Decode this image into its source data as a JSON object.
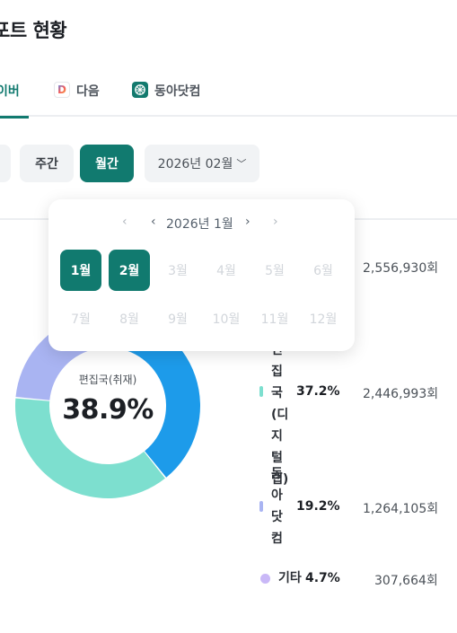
{
  "page": {
    "title": "포트 현황"
  },
  "tabs": [
    {
      "label": "이버",
      "icon": "naver-icon",
      "active": true
    },
    {
      "label": "다음",
      "icon": "daum-icon",
      "active": false
    },
    {
      "label": "동아닷컴",
      "icon": "donga-icon",
      "active": false
    }
  ],
  "filters": {
    "week_label": "주간",
    "month_label": "월간",
    "date_value": "2026년 02월",
    "date_chevron": "﹀"
  },
  "colors": {
    "accent": "#117a6f",
    "cyan": "#1d9bea",
    "mint": "#7ddfcf",
    "periwinkle": "#a9b4f2",
    "lavender": "#c9b8f7"
  },
  "donut": {
    "center_label": "편집국(취재)",
    "center_value": "38.9%"
  },
  "chart_data": {
    "type": "pie",
    "series": [
      {
        "name": "",
        "value": 38.9,
        "color": "#1d9bea"
      },
      {
        "name": "편집국 (디지털랩)",
        "value": 37.2,
        "color": "#7ddfcf"
      },
      {
        "name": "동아닷컴",
        "value": 19.2,
        "color": "#a9b4f2"
      },
      {
        "name": "기타",
        "value": 4.7,
        "color": "#c9b8f7"
      }
    ]
  },
  "legend": [
    {
      "name_lines": [
        "",
        ""
      ],
      "pct": "",
      "count": "2,556,930회"
    },
    {
      "name_lines": [
        "편집",
        "국",
        "(디",
        "지털",
        "랩)"
      ],
      "pct": "37.2%",
      "count": "2,446,993회"
    },
    {
      "name_lines": [
        "동",
        "아",
        "닷",
        "컴"
      ],
      "pct": "19.2%",
      "count": "1,264,105회"
    },
    {
      "name_lines": [
        "기타"
      ],
      "pct": "4.7%",
      "count": "307,664회"
    }
  ],
  "calendar": {
    "year_label": "2026년 1월",
    "prev_year": "‹",
    "prev_month": "‹",
    "next_month": "›",
    "next_year": "›",
    "months": [
      "1월",
      "2월",
      "3월",
      "4월",
      "5월",
      "6월",
      "7월",
      "8월",
      "9월",
      "10월",
      "11월",
      "12월"
    ],
    "selectable": [
      true,
      true,
      false,
      false,
      false,
      false,
      false,
      false,
      false,
      false,
      false,
      false
    ]
  }
}
